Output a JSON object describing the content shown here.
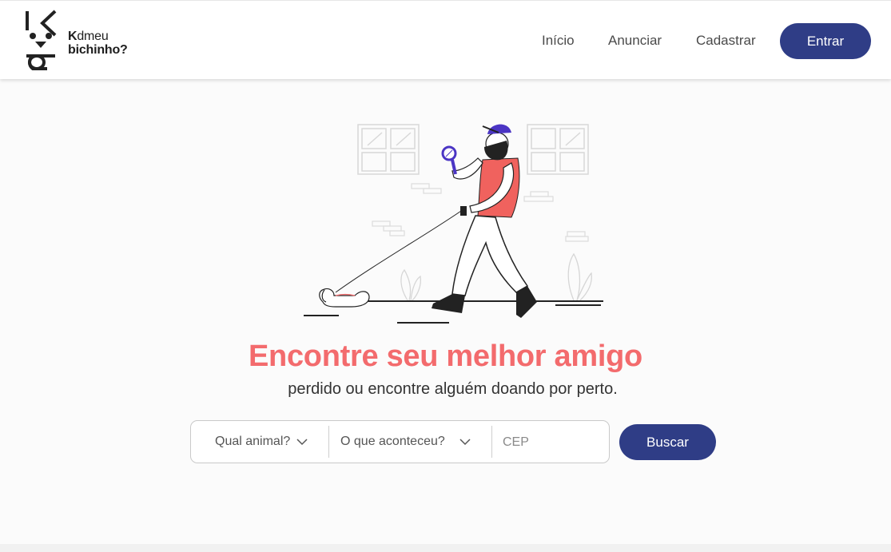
{
  "brand": {
    "line1_bold": "K",
    "line1_rest": "dmeu",
    "line2_bold": "b",
    "line2_rest": "ichinho?"
  },
  "nav": {
    "items": [
      "Início",
      "Anunciar",
      "Cadastrar"
    ],
    "login_label": "Entrar"
  },
  "hero": {
    "title": "Encontre seu melhor amigo",
    "subtitle": "perdido ou encontre alguém doando por perto."
  },
  "search": {
    "animal_select": "Qual animal?",
    "event_select": "O que aconteceu?",
    "cep_placeholder": "CEP",
    "button_label": "Buscar"
  },
  "colors": {
    "primary": "#2f3d86",
    "accent": "#f36b6d",
    "text": "#333333"
  },
  "icons": {
    "chevron": "chevron-down-icon",
    "logo": "dog-face-logo-icon"
  }
}
